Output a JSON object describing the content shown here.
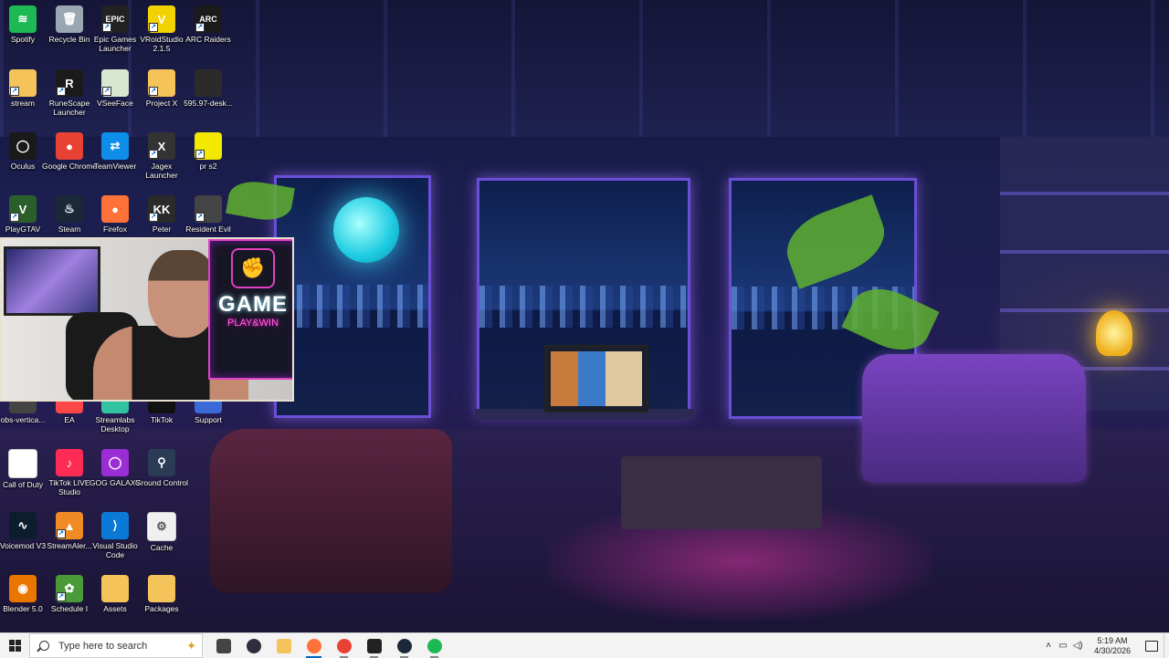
{
  "desktop_icons": [
    {
      "label": "Spotify",
      "col": 0,
      "row": 0,
      "color": "#1db954",
      "glyph": "≋",
      "shortcut": false
    },
    {
      "label": "Recycle Bin",
      "col": 1,
      "row": 0,
      "color": "#9aa6b2",
      "glyph": "🗑",
      "shortcut": false
    },
    {
      "label": "Epic Games Launcher",
      "col": 2,
      "row": 0,
      "color": "#222222",
      "glyph": "EPIC",
      "shortcut": true
    },
    {
      "label": "VRoidStudio 2.1.5",
      "col": 3,
      "row": 0,
      "color": "#f2d200",
      "glyph": "V",
      "shortcut": true
    },
    {
      "label": "ARC Raiders",
      "col": 4,
      "row": 0,
      "color": "#1a1a1a",
      "glyph": "ARC",
      "shortcut": true
    },
    {
      "label": "stream",
      "col": 0,
      "row": 1,
      "color": "#f4c45a",
      "glyph": "",
      "shortcut": true
    },
    {
      "label": "RuneScape Launcher",
      "col": 1,
      "row": 1,
      "color": "#1a1a1a",
      "glyph": "R",
      "shortcut": true
    },
    {
      "label": "VSeeFace",
      "col": 2,
      "row": 1,
      "color": "#d8e8d0",
      "glyph": "",
      "shortcut": true
    },
    {
      "label": "Project X",
      "col": 3,
      "row": 1,
      "color": "#f4c45a",
      "glyph": "",
      "shortcut": true
    },
    {
      "label": "595.97-desk...",
      "col": 4,
      "row": 1,
      "color": "#2b2b2b",
      "glyph": "",
      "shortcut": false
    },
    {
      "label": "Oculus",
      "col": 0,
      "row": 2,
      "color": "#1a1a1a",
      "glyph": "◯",
      "shortcut": false
    },
    {
      "label": "Google Chrome",
      "col": 1,
      "row": 2,
      "color": "#e94235",
      "glyph": "●",
      "shortcut": false
    },
    {
      "label": "TeamViewer",
      "col": 2,
      "row": 2,
      "color": "#0e8ee9",
      "glyph": "⇄",
      "shortcut": false
    },
    {
      "label": "Jagex Launcher",
      "col": 3,
      "row": 2,
      "color": "#333333",
      "glyph": "X",
      "shortcut": true
    },
    {
      "label": "pr s2",
      "col": 4,
      "row": 2,
      "color": "#f2e800",
      "glyph": "",
      "shortcut": true
    },
    {
      "label": "PlayGTAV",
      "col": 0,
      "row": 3,
      "color": "#2a5e2a",
      "glyph": "V",
      "shortcut": true
    },
    {
      "label": "Steam",
      "col": 1,
      "row": 3,
      "color": "#1b2838",
      "glyph": "♨",
      "shortcut": false
    },
    {
      "label": "Firefox",
      "col": 2,
      "row": 3,
      "color": "#ff7139",
      "glyph": "●",
      "shortcut": false
    },
    {
      "label": "Peter",
      "col": 3,
      "row": 3,
      "color": "#2a2a2a",
      "glyph": "KK",
      "shortcut": true
    },
    {
      "label": "Resident Evil",
      "col": 4,
      "row": 3,
      "color": "#444444",
      "glyph": "",
      "shortcut": true
    },
    {
      "label": "obs-vertica...",
      "col": 0,
      "row": 6,
      "color": "#444444",
      "glyph": "",
      "shortcut": false
    },
    {
      "label": "EA",
      "col": 1,
      "row": 6,
      "color": "#ff4747",
      "glyph": "",
      "shortcut": false
    },
    {
      "label": "Streamlabs Desktop",
      "col": 2,
      "row": 6,
      "color": "#31c3a2",
      "glyph": "",
      "shortcut": false
    },
    {
      "label": "TikTok",
      "col": 3,
      "row": 6,
      "color": "#111111",
      "glyph": "",
      "shortcut": false
    },
    {
      "label": "Support",
      "col": 4,
      "row": 6,
      "color": "#3a6ad6",
      "glyph": "",
      "shortcut": false
    },
    {
      "label": "Call of Duty",
      "col": 0,
      "row": 7,
      "color": "#ffffff",
      "glyph": "",
      "shortcut": false
    },
    {
      "label": "TikTok LIVE Studio",
      "col": 1,
      "row": 7,
      "color": "#fe2c55",
      "glyph": "♪",
      "shortcut": false
    },
    {
      "label": "GOG GALAXY",
      "col": 2,
      "row": 7,
      "color": "#9b2dd4",
      "glyph": "◯",
      "shortcut": false
    },
    {
      "label": "Ground Control",
      "col": 3,
      "row": 7,
      "color": "#2b3b55",
      "glyph": "⚲",
      "shortcut": false
    },
    {
      "label": "Voicemod V3",
      "col": 0,
      "row": 8,
      "color": "#0c1d2e",
      "glyph": "∿",
      "shortcut": false
    },
    {
      "label": "StreamAler...",
      "col": 1,
      "row": 8,
      "color": "#f08a24",
      "glyph": "▲",
      "shortcut": true
    },
    {
      "label": "Visual Studio Code",
      "col": 2,
      "row": 8,
      "color": "#0a7ad6",
      "glyph": "⟩",
      "shortcut": false
    },
    {
      "label": "Cache",
      "col": 3,
      "row": 8,
      "color": "#f0f0f0",
      "glyph": "⚙",
      "shortcut": false
    },
    {
      "label": "Blender 5.0",
      "col": 0,
      "row": 9,
      "color": "#ea7600",
      "glyph": "◉",
      "shortcut": false
    },
    {
      "label": "Schedule I",
      "col": 1,
      "row": 9,
      "color": "#4a9a3a",
      "glyph": "✿",
      "shortcut": true
    },
    {
      "label": "Assets",
      "col": 2,
      "row": 9,
      "color": "#f4c45a",
      "glyph": "",
      "shortcut": false
    },
    {
      "label": "Packages",
      "col": 3,
      "row": 9,
      "color": "#f4c45a",
      "glyph": "",
      "shortcut": false
    }
  ],
  "webcam_sign": {
    "word": "GAME",
    "sub": "PLAY&WIN"
  },
  "taskbar": {
    "search_placeholder": "Type here to search",
    "pinned": [
      {
        "name": "task-view-icon",
        "color": "#444444"
      },
      {
        "name": "obs-icon",
        "color": "#302e3c"
      },
      {
        "name": "file-explorer-icon",
        "color": "#f4c45a"
      },
      {
        "name": "firefox-icon",
        "color": "#ff7139",
        "active": true
      },
      {
        "name": "chrome-icon",
        "color": "#e94235",
        "open": true
      },
      {
        "name": "vroid-icon",
        "color": "#222222",
        "open": true
      },
      {
        "name": "steam-icon",
        "color": "#1b2838",
        "open": true
      },
      {
        "name": "spotify-icon",
        "color": "#1db954",
        "open": true
      }
    ],
    "clock_time": "5:19 AM",
    "clock_date": "4/30/2026"
  }
}
